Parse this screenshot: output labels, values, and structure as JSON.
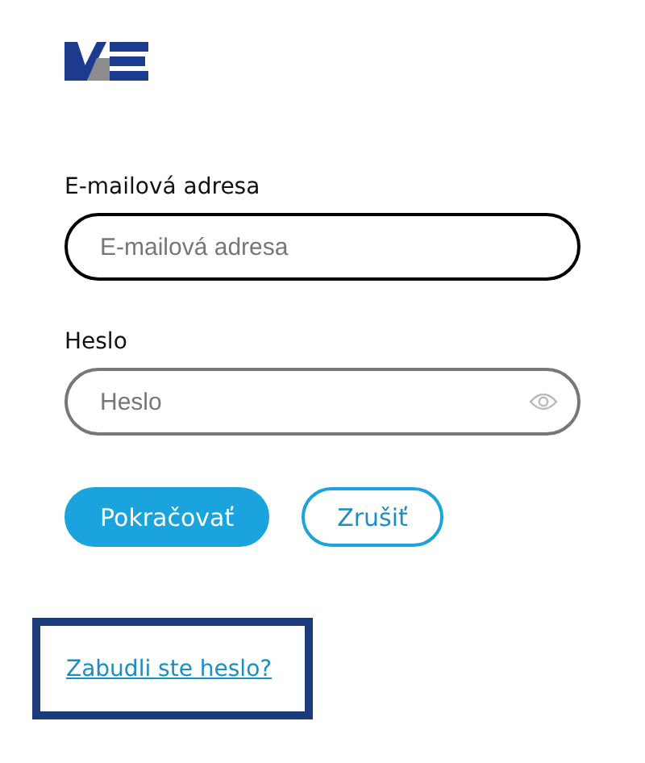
{
  "fields": [
    {
      "label": "E-mailová adresa",
      "placeholder": "E-mailová adresa",
      "kind": "email",
      "focused": true
    },
    {
      "label": "Heslo",
      "placeholder": "Heslo",
      "kind": "password",
      "focused": false
    }
  ],
  "buttons": [
    {
      "label": "Pokračovať",
      "kind": "primary"
    },
    {
      "label": "Zrušiť",
      "kind": "secondary"
    }
  ],
  "link": {
    "text": "Zabudli ste heslo?",
    "highlighted": true
  }
}
